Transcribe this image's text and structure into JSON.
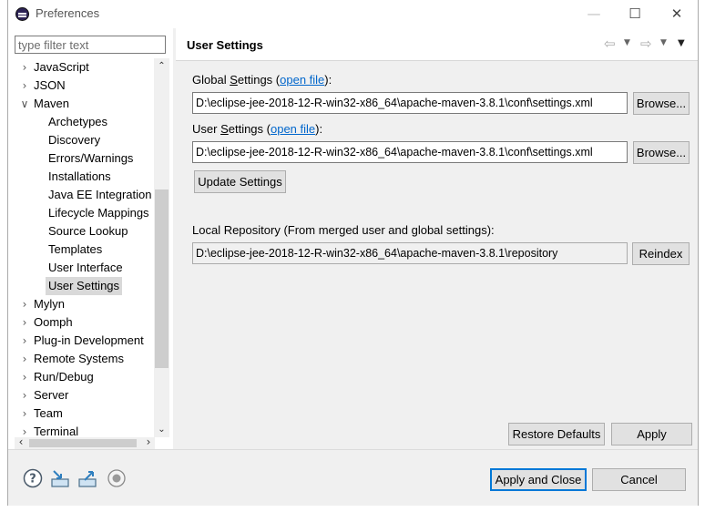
{
  "window": {
    "title": "Preferences",
    "icon": "eclipse-icon",
    "controls": [
      "minimize-icon",
      "maximize-icon",
      "close-icon"
    ]
  },
  "filter": {
    "placeholder": "type filter text",
    "value": ""
  },
  "tree": {
    "items": [
      {
        "label": "JavaScript",
        "arrow": ">",
        "depth": 0
      },
      {
        "label": "JSON",
        "arrow": ">",
        "depth": 0
      },
      {
        "label": "Maven",
        "arrow": "v",
        "depth": 0
      },
      {
        "label": "Archetypes",
        "arrow": "",
        "depth": 1
      },
      {
        "label": "Discovery",
        "arrow": "",
        "depth": 1
      },
      {
        "label": "Errors/Warnings",
        "arrow": "",
        "depth": 1
      },
      {
        "label": "Installations",
        "arrow": "",
        "depth": 1
      },
      {
        "label": "Java EE Integration",
        "arrow": "",
        "depth": 1
      },
      {
        "label": "Lifecycle Mappings",
        "arrow": "",
        "depth": 1
      },
      {
        "label": "Source Lookup",
        "arrow": "",
        "depth": 1
      },
      {
        "label": "Templates",
        "arrow": "",
        "depth": 1
      },
      {
        "label": "User Interface",
        "arrow": "",
        "depth": 1
      },
      {
        "label": "User Settings",
        "arrow": "",
        "depth": 1,
        "selected": true
      },
      {
        "label": "Mylyn",
        "arrow": ">",
        "depth": 0
      },
      {
        "label": "Oomph",
        "arrow": ">",
        "depth": 0
      },
      {
        "label": "Plug-in Development",
        "arrow": ">",
        "depth": 0
      },
      {
        "label": "Remote Systems",
        "arrow": ">",
        "depth": 0
      },
      {
        "label": "Run/Debug",
        "arrow": ">",
        "depth": 0
      },
      {
        "label": "Server",
        "arrow": ">",
        "depth": 0
      },
      {
        "label": "Team",
        "arrow": ">",
        "depth": 0
      },
      {
        "label": "Terminal",
        "arrow": ">",
        "depth": 0
      }
    ]
  },
  "page": {
    "title": "User Settings",
    "global_label_pre": "Global ",
    "global_label_mnemonic": "S",
    "global_label_post": "ettings (",
    "global_link": "open file",
    "global_label_end": "):",
    "global_path": "D:\\eclipse-jee-2018-12-R-win32-x86_64\\apache-maven-3.8.1\\conf\\settings.xml",
    "user_label_pre": "User ",
    "user_label_mnemonic": "S",
    "user_label_post": "ettings (",
    "user_link": "open file",
    "user_label_end": "):",
    "user_path": "D:\\eclipse-jee-2018-12-R-win32-x86_64\\apache-maven-3.8.1\\conf\\settings.xml",
    "browse_label": "Browse...",
    "update_label": "Update Settings",
    "local_repo_label": "Local Repository (From merged user and global settings):",
    "local_repo_path": "D:\\eclipse-jee-2018-12-R-win32-x86_64\\apache-maven-3.8.1\\repository",
    "reindex_label": "Reindex",
    "restore_label": "Restore Defaults",
    "apply_label": "Apply"
  },
  "footer": {
    "apply_close_label": "Apply and Close",
    "cancel_label": "Cancel",
    "icons": [
      "help-icon",
      "import-icon",
      "export-icon",
      "record-icon"
    ]
  },
  "colors": {
    "link": "#0066cc",
    "primary_border": "#0078d7",
    "selected_row": "#d9d9d9"
  }
}
